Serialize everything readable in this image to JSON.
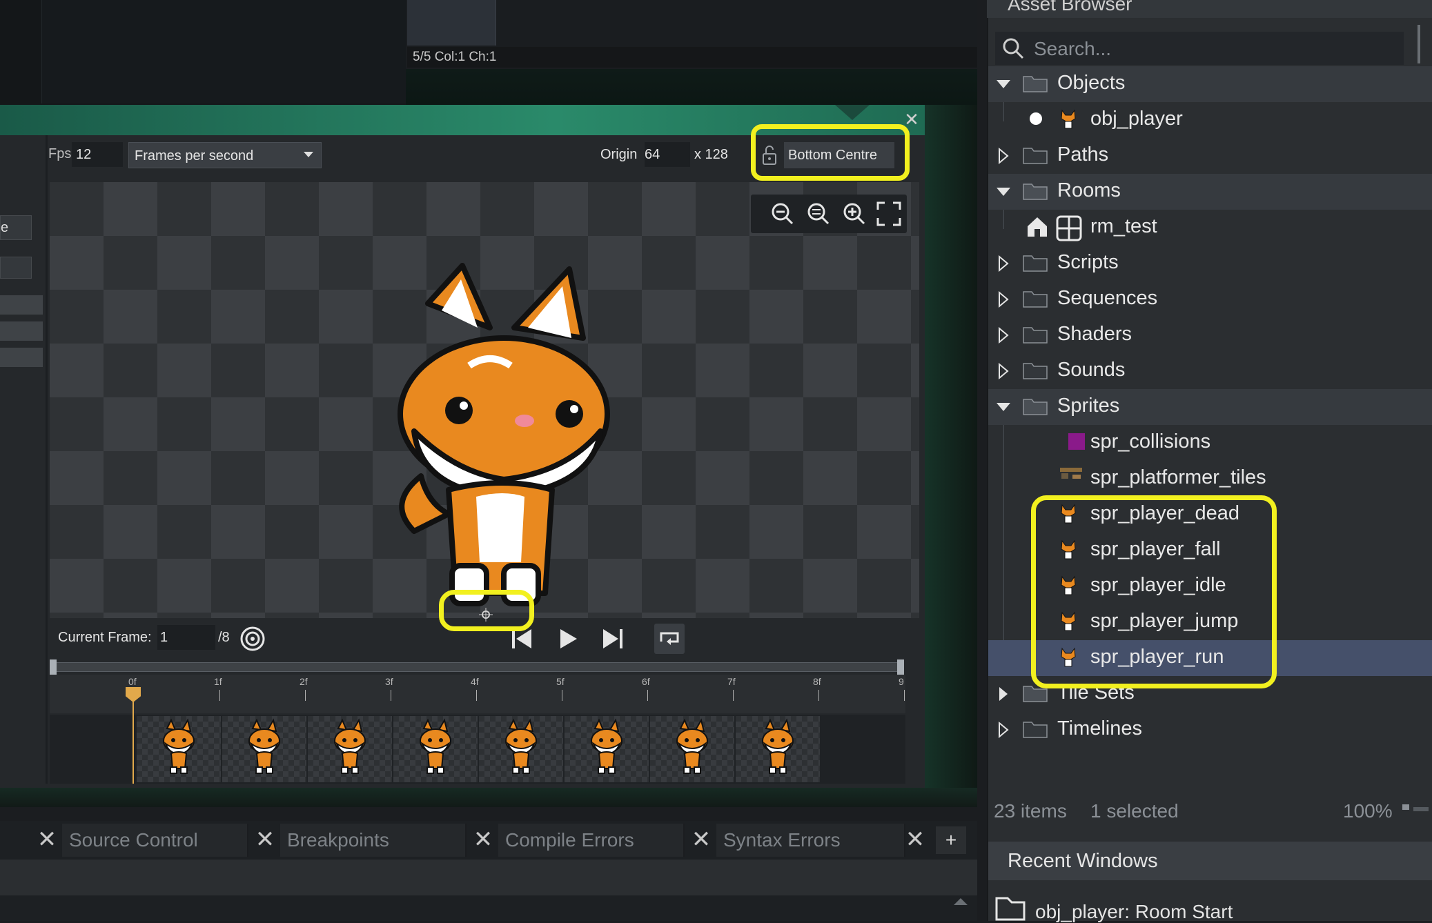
{
  "code_editor": {
    "status": "5/5 Col:1 Ch:1"
  },
  "sprite_editor": {
    "fps_label": "Fps",
    "fps_value": "12",
    "fps_mode": "Frames per second",
    "origin_label": "Origin",
    "origin_x": "64",
    "origin_y_label": "x 128",
    "origin_preset": "Bottom Centre",
    "left_stub_text": "e",
    "current_frame_label": "Current Frame:",
    "current_frame_value": "1",
    "frame_total": "/8",
    "timeline_ticks": [
      "0f",
      "1f",
      "2f",
      "3f",
      "4f",
      "5f",
      "6f",
      "7f",
      "8f",
      "9"
    ],
    "playhead_frame": 0,
    "frame_count": 8
  },
  "bottom_tabs": [
    {
      "label": "Source Control"
    },
    {
      "label": "Breakpoints"
    },
    {
      "label": "Compile Errors"
    },
    {
      "label": "Syntax Errors"
    }
  ],
  "add_tab_label": "+",
  "asset_browser": {
    "title": "Asset Browser",
    "search_placeholder": "Search...",
    "tree": {
      "objects": "Objects",
      "obj_player": "obj_player",
      "paths": "Paths",
      "rooms": "Rooms",
      "rm_test": "rm_test",
      "scripts": "Scripts",
      "sequences": "Sequences",
      "shaders": "Shaders",
      "sounds": "Sounds",
      "sprites": "Sprites",
      "spr_collisions": "spr_collisions",
      "spr_platformer_tiles": "spr_platformer_tiles",
      "spr_player_dead": "spr_player_dead",
      "spr_player_fall": "spr_player_fall",
      "spr_player_idle": "spr_player_idle",
      "spr_player_jump": "spr_player_jump",
      "spr_player_run": "spr_player_run",
      "tile_sets": "Tile Sets",
      "timelines": "Timelines"
    },
    "item_count": "23 items",
    "selected_count": "1 selected",
    "zoom": "100%"
  },
  "recent_windows": {
    "title": "Recent Windows",
    "item": "obj_player: Room Start"
  },
  "colors": {
    "highlight": "#f2f01f",
    "header_green": "#2a8a6a",
    "selection": "#45506a",
    "playhead": "#e2a94b",
    "collision_swatch": "#8a1a8a"
  },
  "icons": [
    "search-icon",
    "caret-down-icon",
    "caret-right-icon",
    "folder-icon",
    "house-icon",
    "room-grid-icon",
    "lock-icon",
    "zoom-out-icon",
    "zoom-reset-icon",
    "zoom-in-icon",
    "fit-screen-icon",
    "first-frame-icon",
    "play-icon",
    "last-frame-icon",
    "loop-icon",
    "onion-skin-icon",
    "close-icon",
    "fox-sprite-icon",
    "tileset-icon"
  ]
}
